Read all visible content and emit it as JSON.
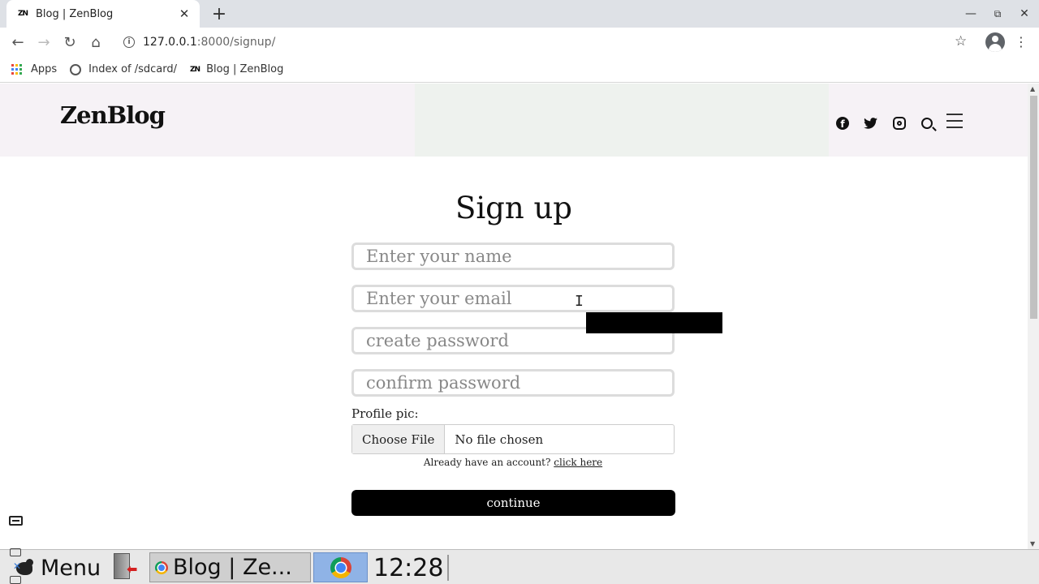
{
  "browser": {
    "tab_title": "Blog | ZenBlog",
    "tab_favicon": "ZN",
    "url_host": "127.0.0.1",
    "url_rest": ":8000/signup/",
    "bookmarks": [
      {
        "label": "Apps",
        "icon": "apps-grid-icon"
      },
      {
        "label": "Index of /sdcard/",
        "icon": "globe-icon"
      },
      {
        "label": "Blog | ZenBlog",
        "icon": "zn-icon",
        "favicon": "ZN"
      }
    ]
  },
  "site": {
    "logo": "ZenBlog",
    "social_icons": [
      "facebook-icon",
      "twitter-icon",
      "instagram-icon",
      "search-icon",
      "menu-icon"
    ]
  },
  "signup": {
    "title": "Sign up",
    "name_placeholder": "Enter your name",
    "email_placeholder": "Enter your email",
    "password_placeholder": "create password",
    "confirm_placeholder": "confirm password",
    "profile_label": "Profile pic:",
    "choose_file": "Choose File",
    "no_file": "No file chosen",
    "already_text": "Already have an account?",
    "already_link": "click here",
    "continue_label": "continue"
  },
  "taskbar": {
    "menu_label": "Menu",
    "task_label": "Blog | Ze...",
    "clock": "12:28"
  }
}
